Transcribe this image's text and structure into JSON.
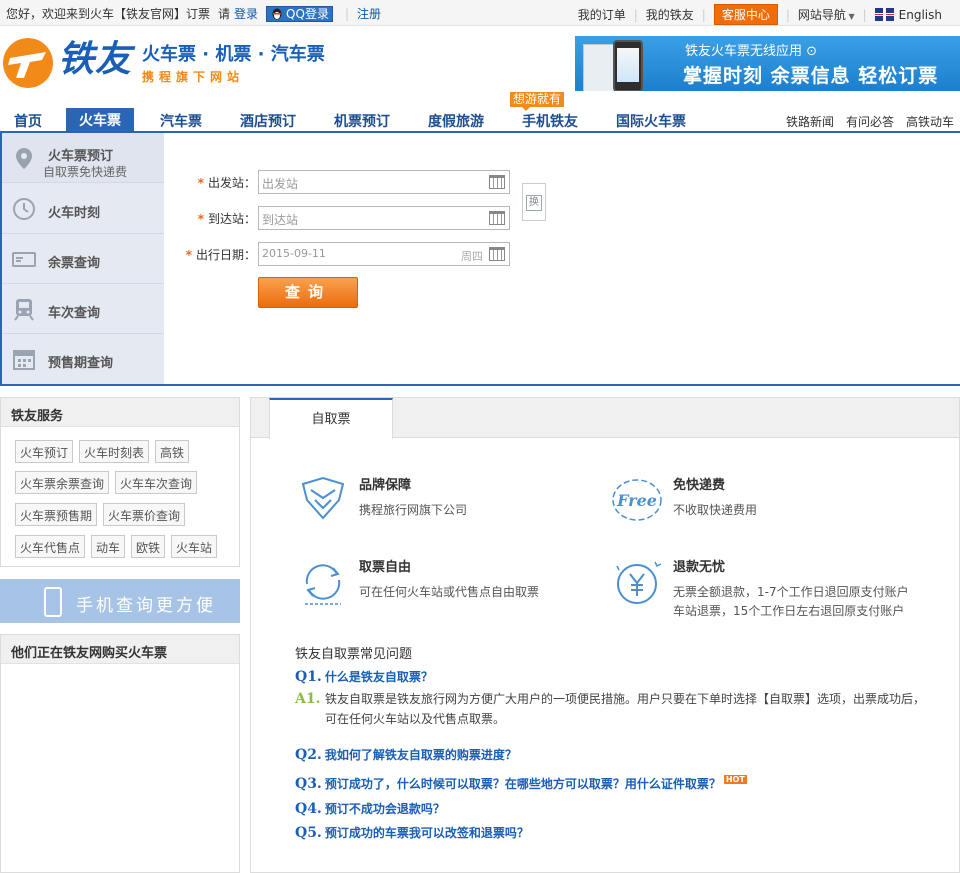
{
  "topbar": {
    "greeting": "您好，欢迎来到火车【铁友官网】订票",
    "please": "请",
    "login": "登录",
    "qq_login": "QQ登录",
    "register": "注册",
    "my_orders": "我的订单",
    "my_tieyou": "我的铁友",
    "customer_service": "客服中心",
    "site_nav": "网站导航",
    "language": "English"
  },
  "header": {
    "logo_text": "铁友",
    "tagline": "火车票 · 机票 · 汽车票",
    "subline": "携程旗下网站",
    "banner_line1": "铁友火车票无线应用 ⊙",
    "banner_line2": "掌握时刻  余票信息  轻松订票"
  },
  "nav": {
    "items": [
      "首页",
      "火车票",
      "汽车票",
      "酒店预订",
      "机票预订",
      "度假旅游",
      "手机铁友",
      "国际火车票"
    ],
    "hot_tag": "想游就有",
    "right_links": [
      "铁路新闻",
      "有问必答",
      "高铁动车"
    ]
  },
  "side_menu": [
    {
      "label": "火车票预订",
      "sub": "自取票免快递费"
    },
    {
      "label": "火车时刻",
      "sub": ""
    },
    {
      "label": "余票查询",
      "sub": ""
    },
    {
      "label": "车次查询",
      "sub": ""
    },
    {
      "label": "预售期查询",
      "sub": ""
    }
  ],
  "form": {
    "required_mark": "*",
    "from_label": "出发站：",
    "from_placeholder": "出发站",
    "to_label": "到达站：",
    "to_placeholder": "到达站",
    "date_label": "出行日期：",
    "date_value": "2015-09-11",
    "weekday": "周四",
    "swap_label": "换",
    "query_button": "查询"
  },
  "services": {
    "title": "铁友服务",
    "tags": [
      "火车预订",
      "火车时刻表",
      "高铁",
      "火车票余票查询",
      "火车车次查询",
      "火车票预售期",
      "火车票价查询",
      "火车代售点",
      "动车",
      "欧铁",
      "火车站"
    ]
  },
  "phone_banner": {
    "text": "手机查询更方便"
  },
  "buying": {
    "title": "他们正在铁友网购买火车票"
  },
  "content": {
    "tab": "自取票",
    "features": [
      {
        "title": "品牌保障",
        "desc": "携程旅行网旗下公司"
      },
      {
        "title": "免快递费",
        "desc": "不收取快递费用"
      },
      {
        "title": "取票自由",
        "desc": "可在任何火车站或代售点自由取票"
      },
      {
        "title": "退款无忧",
        "desc": "无票全额退款，1-7个工作日退回原支付账户",
        "desc2": "车站退票，15个工作日左右退回原支付账户"
      }
    ],
    "free_icon_text": "Free",
    "faq_title": "铁友自取票常见问题",
    "faq": [
      {
        "num": "Q1.",
        "q": "什么是铁友自取票？"
      },
      {
        "num": "Q2.",
        "q": "我如何了解铁友自取票的购票进度？"
      },
      {
        "num": "Q3.",
        "q": "预订成功了，什么时候可以取票？在哪些地方可以取票？用什么证件取票？"
      },
      {
        "num": "Q4.",
        "q": "预订不成功会退款吗？"
      },
      {
        "num": "Q5.",
        "q": "预订成功的车票我可以改签和退票吗？"
      }
    ],
    "answer_num": "A1.",
    "answer1": "铁友自取票是铁友旅行网为方便广大用户的一项便民措施。用户只要在下单时选择【自取票】选项，出票成功后，可在任何火车站以及代售点取票。",
    "hot_badge": "HOT"
  },
  "colors": {
    "brand_blue": "#2a66b4",
    "accent_orange": "#ec6d0d"
  }
}
